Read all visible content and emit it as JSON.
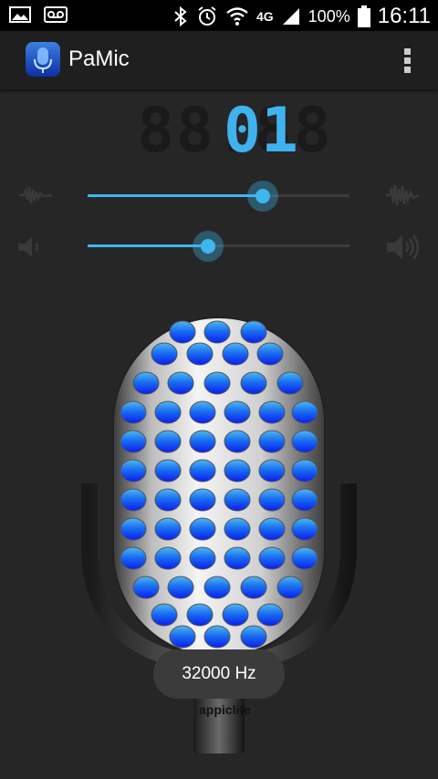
{
  "status_bar": {
    "network": "4G",
    "battery": "100%",
    "time": "16:11"
  },
  "app": {
    "title": "PaMic"
  },
  "display": {
    "ghost_digits": "88.88",
    "value": "01"
  },
  "sliders": {
    "sensitivity": {
      "level": 0.67
    },
    "volume": {
      "level": 0.46
    }
  },
  "microphone": {
    "sample_rate_label": "32000 Hz",
    "brand": "appiclife"
  },
  "colors": {
    "accent": "#40b6ef",
    "background": "#262626",
    "mic_hole_top": "#4fb7f0",
    "mic_hole_bottom": "#0a1ef0"
  }
}
